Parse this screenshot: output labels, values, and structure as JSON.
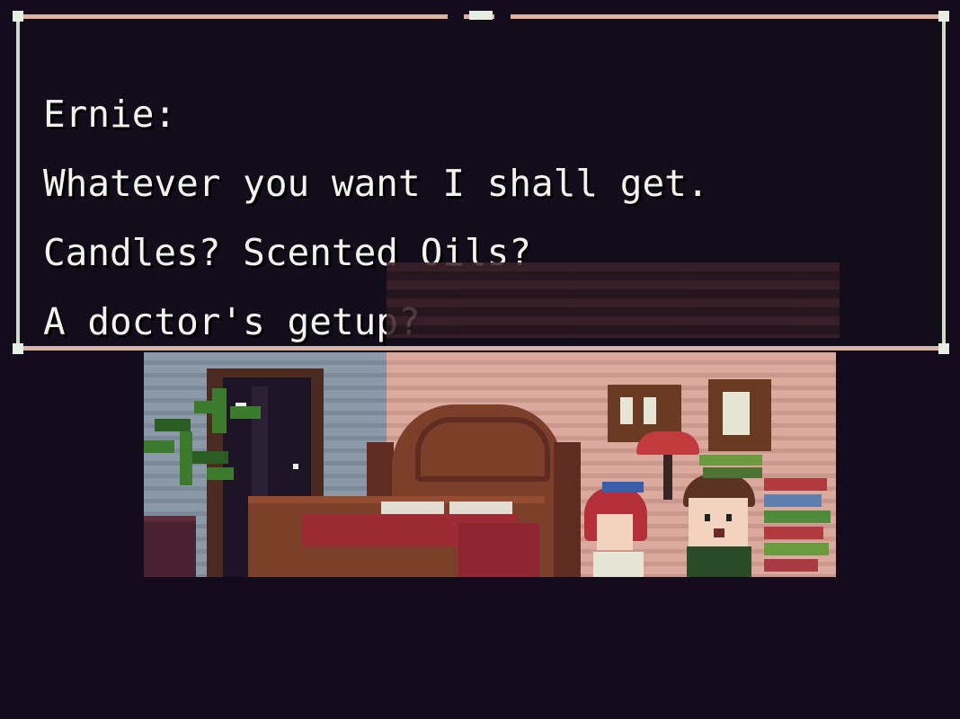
{
  "dialogue": {
    "speaker": "Ernie:",
    "lines": [
      "Whatever you want I shall get.",
      "Candles? Scented Oils?",
      "A doctor's getup?"
    ]
  },
  "colors": {
    "background": "#140c1c",
    "text": "#f3f3ee",
    "border_top": "#d9b3a6",
    "border_side": "#cfd9c8"
  },
  "scene": {
    "description_icons": [
      "plant-icon",
      "door-icon",
      "bed-icon",
      "picture-frame-icon",
      "lamp-icon",
      "book-stack-icon"
    ]
  }
}
